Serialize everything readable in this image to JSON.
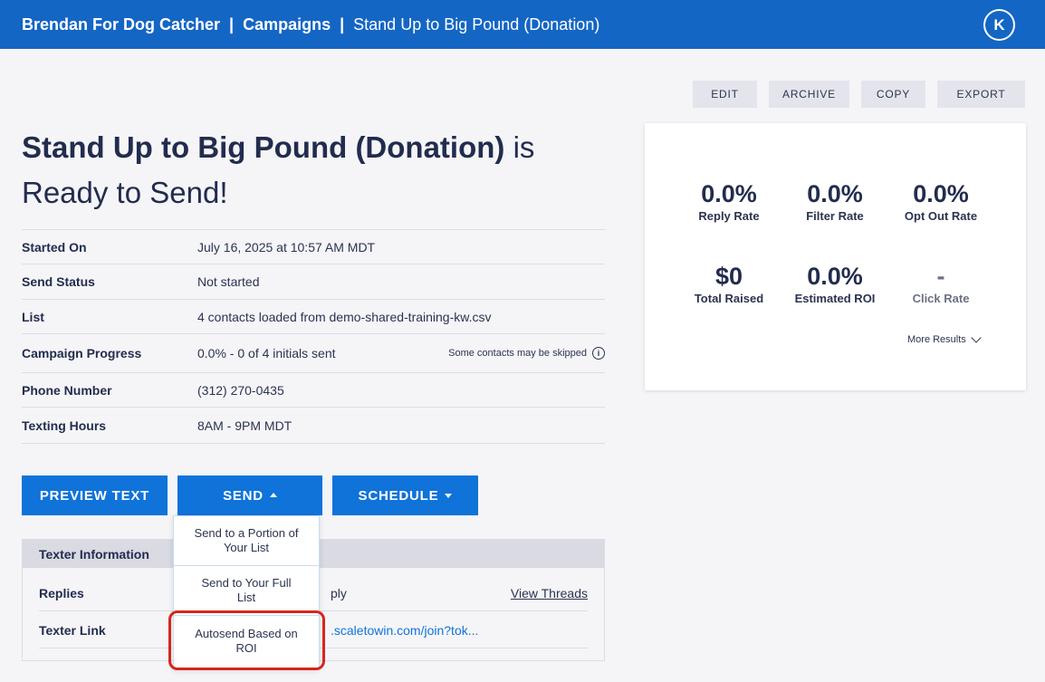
{
  "breadcrumb": {
    "org": "Brendan For Dog Catcher",
    "section": "Campaigns",
    "campaign": "Stand Up to Big Pound (Donation)",
    "sep": "|"
  },
  "user": {
    "avatar_letter": "K"
  },
  "actions": {
    "edit": "EDIT",
    "archive": "ARCHIVE",
    "copy": "COPY",
    "export": "EXPORT"
  },
  "headline": {
    "name": "Stand Up to Big Pound (Donation)",
    "status_text": " is Ready to Send!"
  },
  "info": {
    "started_label": "Started On",
    "started_value": "July 16, 2025 at 10:57 AM MDT",
    "status_label": "Send Status",
    "status_value": "Not started",
    "list_label": "List",
    "list_value": "4 contacts loaded from demo-shared-training-kw.csv",
    "progress_label": "Campaign Progress",
    "progress_value": "0.0% - 0 of 4 initials sent",
    "progress_note": "Some contacts may be skipped",
    "phone_label": "Phone Number",
    "phone_value": "(312) 270-0435",
    "hours_label": "Texting Hours",
    "hours_value": "8AM - 9PM MDT"
  },
  "buttons": {
    "preview": "PREVIEW TEXT",
    "send": "SEND",
    "schedule": "SCHEDULE"
  },
  "send_menu": {
    "portion": "Send to a Portion of Your List",
    "full": "Send to Your Full List",
    "autosend": "Autosend Based on ROI"
  },
  "texter": {
    "header": "Texter Information",
    "replies_label": "Replies",
    "replies_value": "ply",
    "view_threads": "View Threads",
    "link_label": "Texter Link",
    "link_value": ".scaletowin.com/join?tok..."
  },
  "stats": {
    "reply_rate": {
      "value": "0.0%",
      "label": "Reply Rate"
    },
    "filter_rate": {
      "value": "0.0%",
      "label": "Filter Rate"
    },
    "opt_out_rate": {
      "value": "0.0%",
      "label": "Opt Out Rate"
    },
    "total_raised": {
      "value": "$0",
      "label": "Total Raised"
    },
    "estimated_roi": {
      "value": "0.0%",
      "label": "Estimated ROI"
    },
    "click_rate": {
      "value": "-",
      "label": "Click Rate"
    },
    "more": "More Results"
  },
  "colors": {
    "brand": "#1466c4",
    "button": "#0f73d9",
    "highlight": "#d6261c"
  }
}
